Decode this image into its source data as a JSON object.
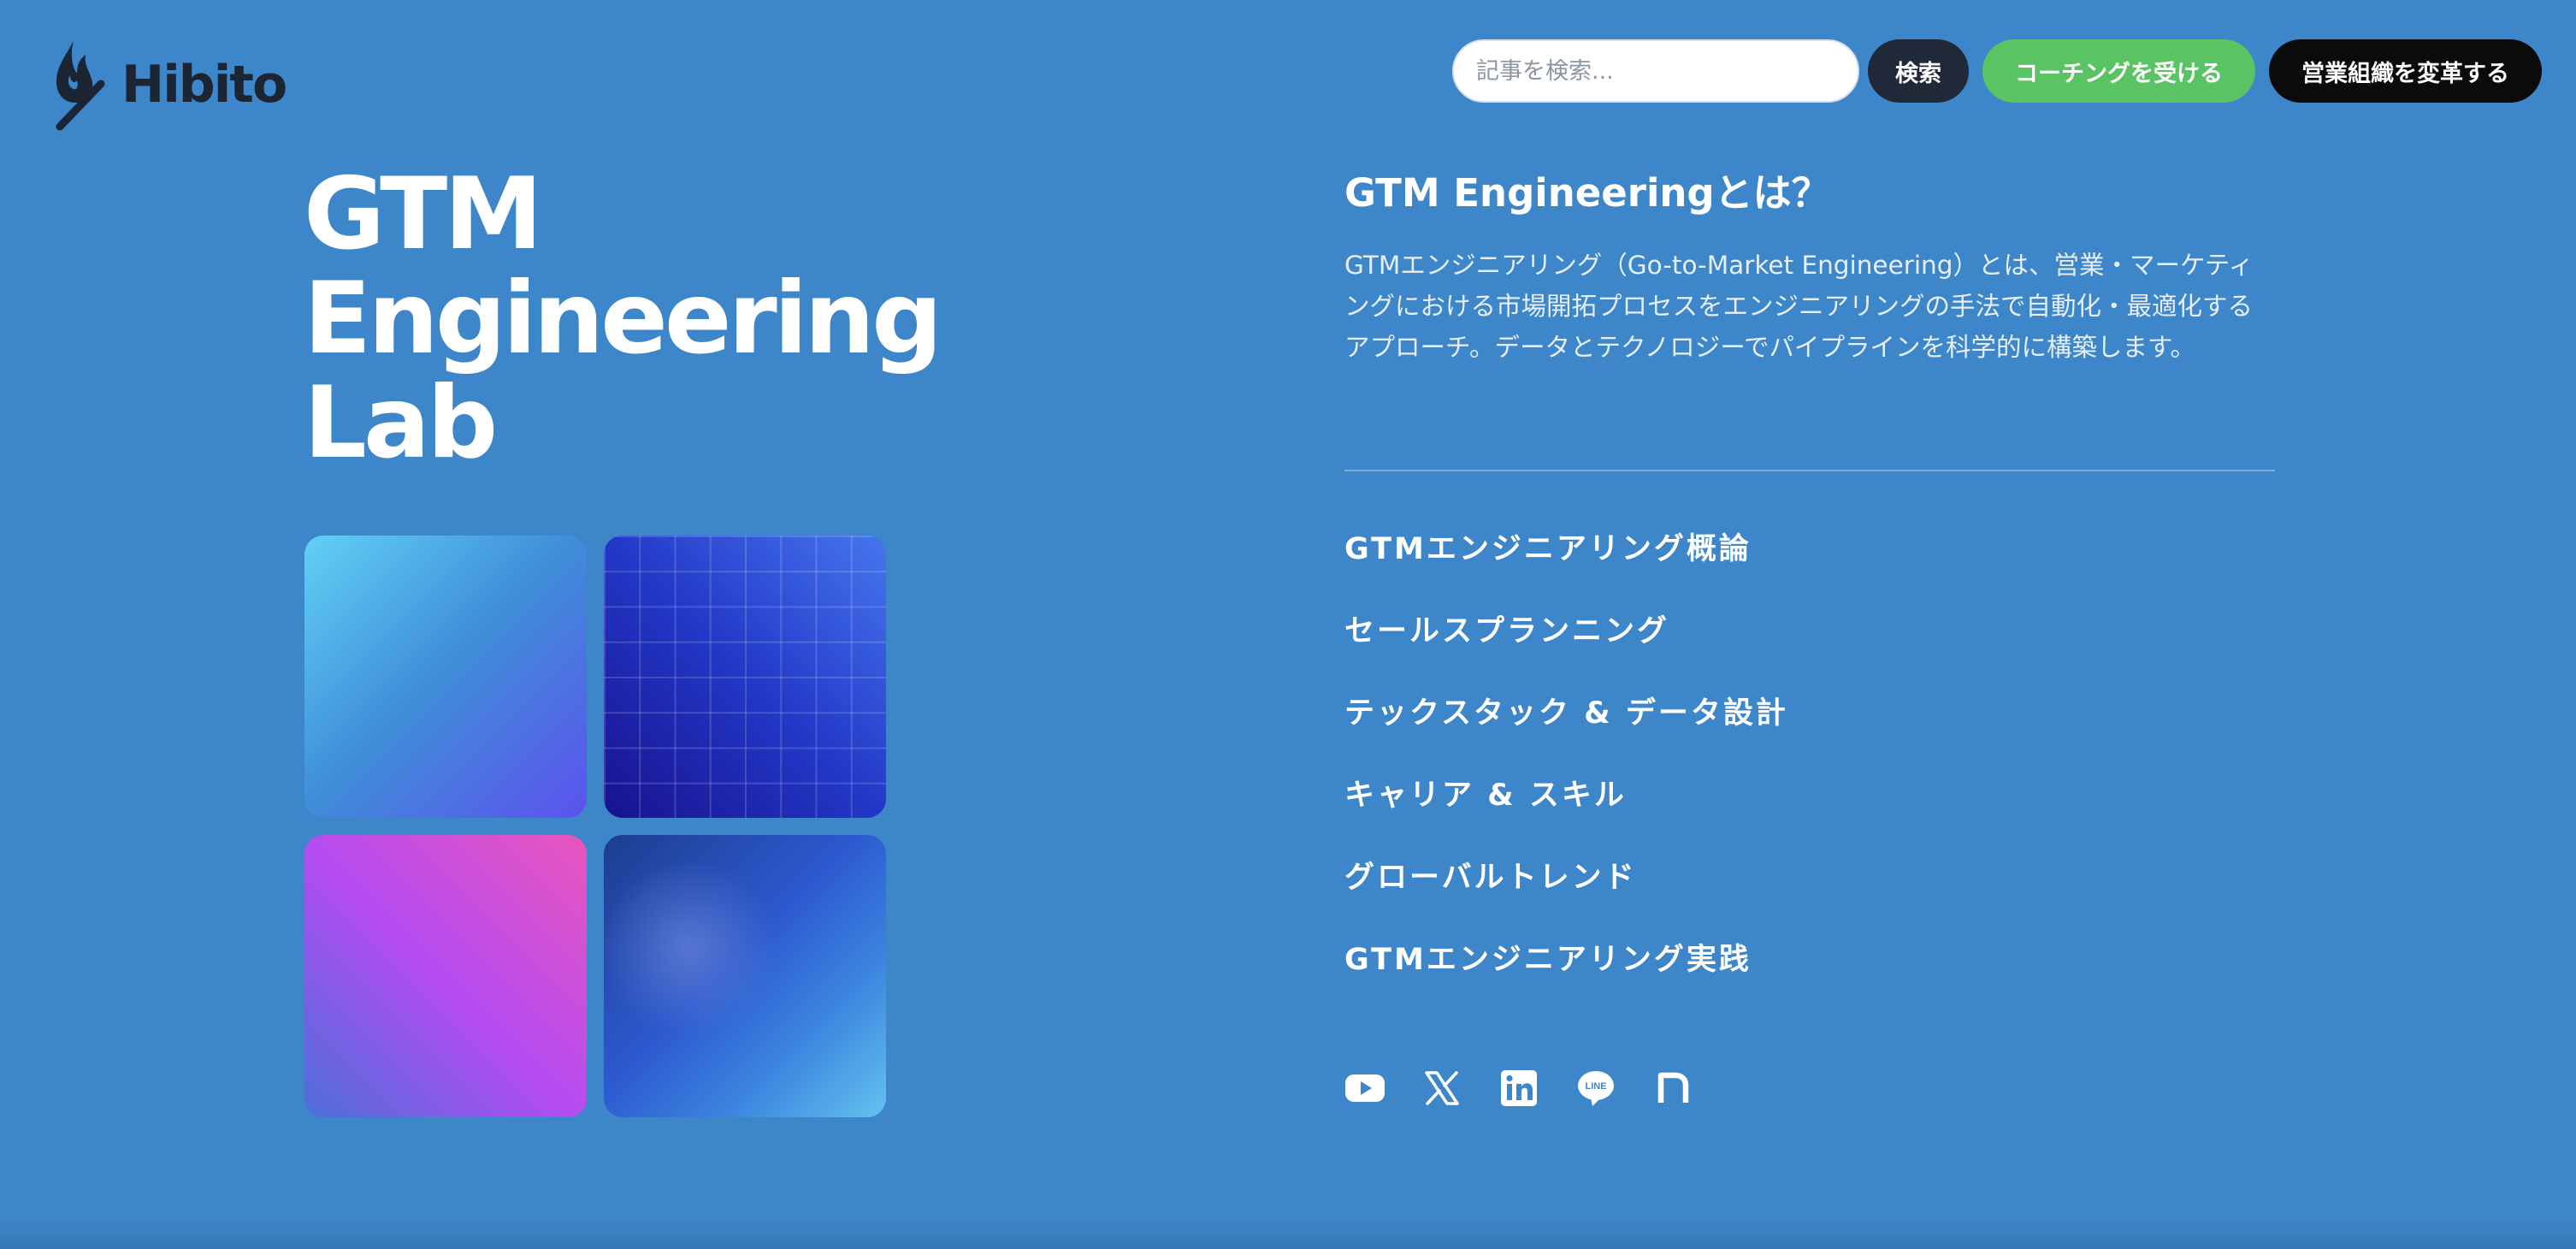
{
  "brand": {
    "logo_text": "Hibito",
    "logo_icon": "flame-match-icon",
    "text_color": "#1c2533"
  },
  "header": {
    "search": {
      "placeholder": "記事を検索...",
      "value": "",
      "button_label": "検索"
    },
    "buttons": {
      "coaching_label": "コーチングを受ける",
      "transform_label": "営業組織を変革する"
    },
    "colors": {
      "search_button": "#1f2937",
      "coaching_button": "#5ac363",
      "transform_button": "#0b0b0b"
    }
  },
  "hero": {
    "title_lines": [
      "GTM",
      "Engineering",
      "Lab"
    ],
    "tiles": [
      "gradient-tile",
      "grid-tile",
      "purple-gradient-tile",
      "blue-glow-tile"
    ]
  },
  "about": {
    "title": "GTM Engineeringとは？",
    "description": "GTMエンジニアリング（Go-to-Market Engineering）とは、営業・マーケティングにおける市場開拓プロセスをエンジニアリングの手法で自動化・最適化するアプローチ。データとテクノロジーでパイプラインを科学的に構築します。"
  },
  "nav": {
    "items": [
      {
        "label": "GTMエンジニアリング概論"
      },
      {
        "label": "セールスプランニング"
      },
      {
        "label": "テックスタック & データ設計"
      },
      {
        "label": "キャリア & スキル"
      },
      {
        "label": "グローバルトレンド"
      },
      {
        "label": "GTMエンジニアリング実践"
      }
    ]
  },
  "social": {
    "icons": [
      "youtube-icon",
      "x-icon",
      "linkedin-icon",
      "line-icon",
      "note-icon"
    ],
    "line_label": "LINE"
  },
  "colors": {
    "background": "#3d86c9",
    "text": "#ffffff"
  }
}
